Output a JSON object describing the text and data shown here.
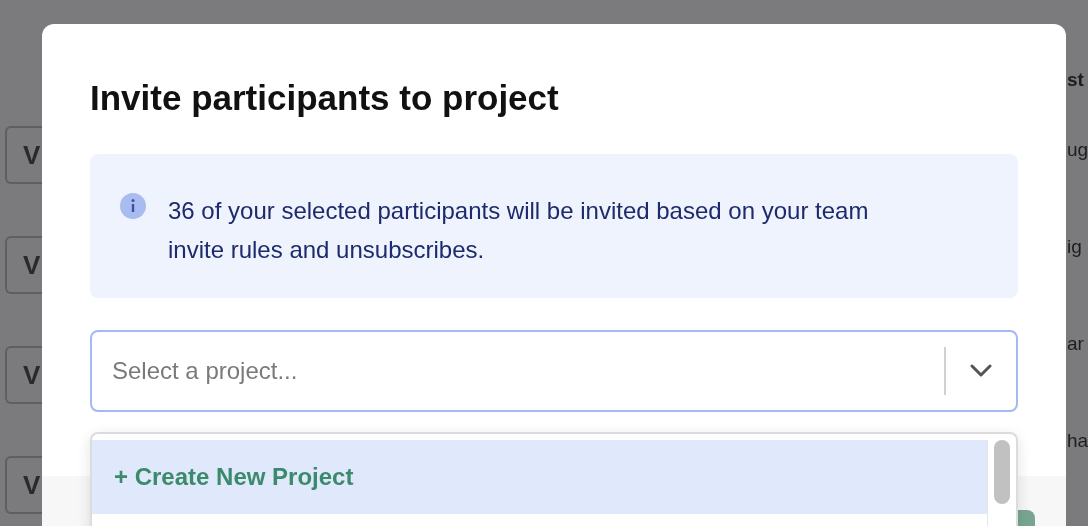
{
  "background": {
    "left_buttons": [
      "V",
      "V",
      "V",
      "V"
    ],
    "right_texts": [
      "st",
      "ug",
      "ig",
      "ar",
      "ha"
    ]
  },
  "dialog": {
    "title": "Invite participants to project",
    "notice": "36 of your selected participants will be invited based on your team invite rules and unsubscribes.",
    "select": {
      "placeholder": "Select a project..."
    },
    "dropdown": {
      "options": [
        {
          "label": "+ Create New Project",
          "selected": true
        }
      ]
    }
  }
}
